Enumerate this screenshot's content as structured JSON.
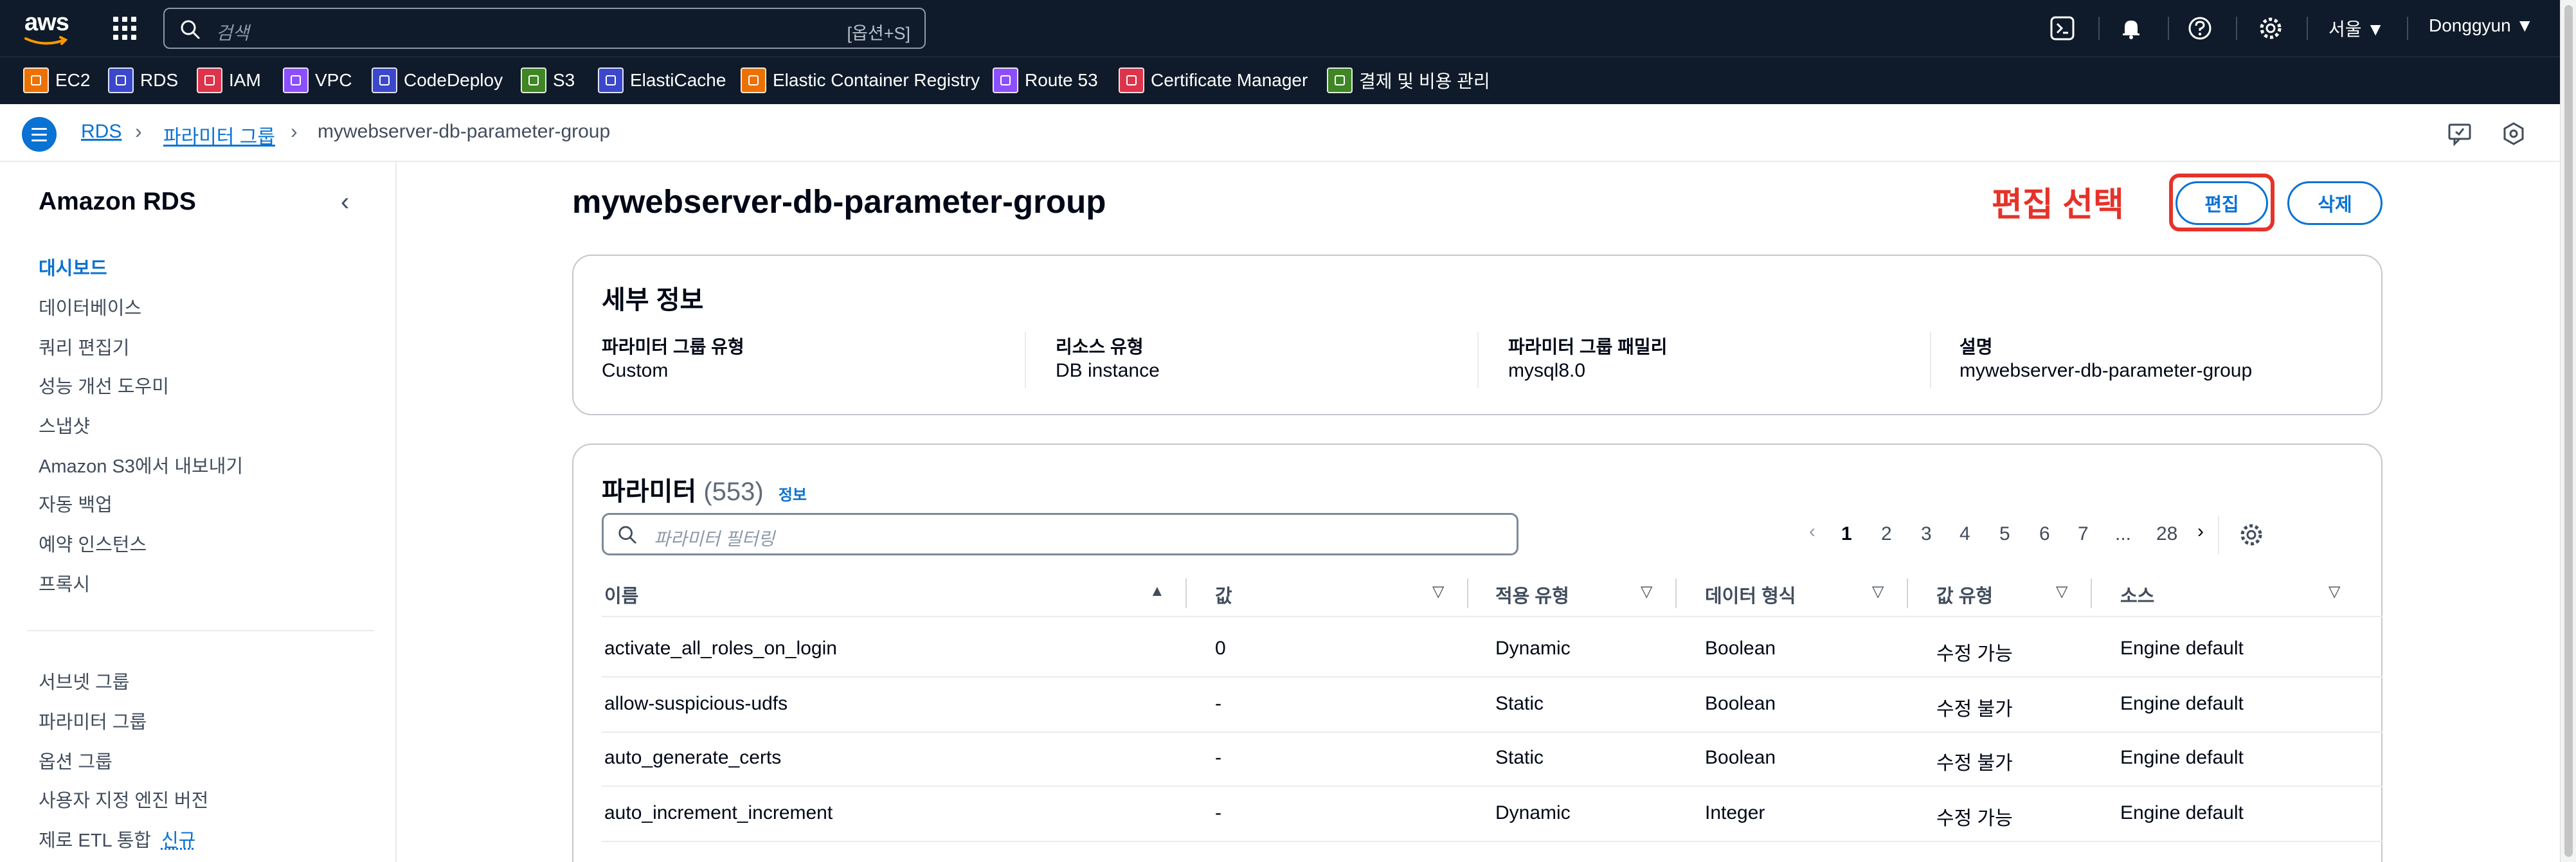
{
  "topnav": {
    "logo": "aws",
    "search_placeholder": "검색",
    "search_shortcut": "[옵션+S]",
    "region": "서울 ▼",
    "user": "Donggyun ▼",
    "icons": [
      "grid-icon",
      "terminal-icon",
      "bell-icon",
      "help-icon",
      "gear-icon"
    ]
  },
  "favorites": [
    {
      "label": "EC2",
      "color": "#ed7100"
    },
    {
      "label": "RDS",
      "color": "#3b48cc"
    },
    {
      "label": "IAM",
      "color": "#dd344c"
    },
    {
      "label": "VPC",
      "color": "#8c4fff"
    },
    {
      "label": "CodeDeploy",
      "color": "#3b48cc"
    },
    {
      "label": "S3",
      "color": "#3f8624"
    },
    {
      "label": "ElastiCache",
      "color": "#3b48cc"
    },
    {
      "label": "Elastic Container Registry",
      "color": "#ed7100"
    },
    {
      "label": "Route 53",
      "color": "#8c4fff"
    },
    {
      "label": "Certificate Manager",
      "color": "#dd344c"
    },
    {
      "label": "결제 및 비용 관리",
      "color": "#3f8624"
    }
  ],
  "breadcrumb": {
    "items": [
      "RDS",
      "파라미터 그룹",
      "mywebserver-db-parameter-group"
    ]
  },
  "sidebar": {
    "title": "Amazon RDS",
    "items": [
      "대시보드",
      "데이터베이스",
      "쿼리 편집기",
      "성능 개선 도우미",
      "스냅샷",
      "Amazon S3에서 내보내기",
      "자동 백업",
      "예약 인스턴스",
      "프록시"
    ],
    "items2": [
      "서브넷 그룹",
      "파라미터 그룹",
      "옵션 그룹",
      "사용자 지정 엔진 버전",
      "제로 ETL 통합"
    ],
    "new_badge": "신규"
  },
  "main": {
    "title": "mywebserver-db-parameter-group",
    "annotation": "편집 선택",
    "edit_label": "편집",
    "delete_label": "삭제",
    "details": {
      "heading": "세부 정보",
      "fields": [
        {
          "label": "파라미터 그룹 유형",
          "value": "Custom"
        },
        {
          "label": "리소스 유형",
          "value": "DB instance"
        },
        {
          "label": "파라미터 그룹 패밀리",
          "value": "mysql8.0"
        },
        {
          "label": "설명",
          "value": "mywebserver-db-parameter-group"
        }
      ]
    },
    "params": {
      "heading": "파라미터",
      "count": "(553)",
      "info": "정보",
      "filter_placeholder": "파라미터 필터링",
      "pages": [
        "1",
        "2",
        "3",
        "4",
        "5",
        "6",
        "7",
        "...",
        "28"
      ],
      "columns": [
        "이름",
        "값",
        "적용 유형",
        "데이터 형식",
        "값 유형",
        "소스"
      ],
      "rows": [
        [
          "activate_all_roles_on_login",
          "0",
          "Dynamic",
          "Boolean",
          "수정 가능",
          "Engine default"
        ],
        [
          "allow-suspicious-udfs",
          "-",
          "Static",
          "Boolean",
          "수정 불가",
          "Engine default"
        ],
        [
          "auto_generate_certs",
          "-",
          "Static",
          "Boolean",
          "수정 불가",
          "Engine default"
        ],
        [
          "auto_increment_increment",
          "-",
          "Dynamic",
          "Integer",
          "수정 가능",
          "Engine default"
        ]
      ]
    }
  }
}
